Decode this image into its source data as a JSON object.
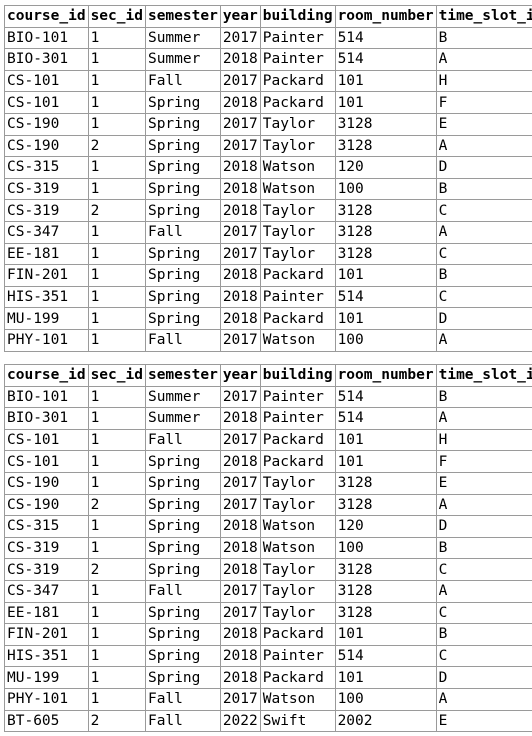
{
  "columns": [
    "course_id",
    "sec_id",
    "semester",
    "year",
    "building",
    "room_number",
    "time_slot_id"
  ],
  "result_before": {
    "rows": [
      [
        "BIO-101",
        "1",
        "Summer",
        "2017",
        "Painter",
        "514",
        "B"
      ],
      [
        "BIO-301",
        "1",
        "Summer",
        "2018",
        "Painter",
        "514",
        "A"
      ],
      [
        "CS-101",
        "1",
        "Fall",
        "2017",
        "Packard",
        "101",
        "H"
      ],
      [
        "CS-101",
        "1",
        "Spring",
        "2018",
        "Packard",
        "101",
        "F"
      ],
      [
        "CS-190",
        "1",
        "Spring",
        "2017",
        "Taylor",
        "3128",
        "E"
      ],
      [
        "CS-190",
        "2",
        "Spring",
        "2017",
        "Taylor",
        "3128",
        "A"
      ],
      [
        "CS-315",
        "1",
        "Spring",
        "2018",
        "Watson",
        "120",
        "D"
      ],
      [
        "CS-319",
        "1",
        "Spring",
        "2018",
        "Watson",
        "100",
        "B"
      ],
      [
        "CS-319",
        "2",
        "Spring",
        "2018",
        "Taylor",
        "3128",
        "C"
      ],
      [
        "CS-347",
        "1",
        "Fall",
        "2017",
        "Taylor",
        "3128",
        "A"
      ],
      [
        "EE-181",
        "1",
        "Spring",
        "2017",
        "Taylor",
        "3128",
        "C"
      ],
      [
        "FIN-201",
        "1",
        "Spring",
        "2018",
        "Packard",
        "101",
        "B"
      ],
      [
        "HIS-351",
        "1",
        "Spring",
        "2018",
        "Painter",
        "514",
        "C"
      ],
      [
        "MU-199",
        "1",
        "Spring",
        "2018",
        "Packard",
        "101",
        "D"
      ],
      [
        "PHY-101",
        "1",
        "Fall",
        "2017",
        "Watson",
        "100",
        "A"
      ]
    ]
  },
  "result_after": {
    "rows": [
      [
        "BIO-101",
        "1",
        "Summer",
        "2017",
        "Painter",
        "514",
        "B"
      ],
      [
        "BIO-301",
        "1",
        "Summer",
        "2018",
        "Painter",
        "514",
        "A"
      ],
      [
        "CS-101",
        "1",
        "Fall",
        "2017",
        "Packard",
        "101",
        "H"
      ],
      [
        "CS-101",
        "1",
        "Spring",
        "2018",
        "Packard",
        "101",
        "F"
      ],
      [
        "CS-190",
        "1",
        "Spring",
        "2017",
        "Taylor",
        "3128",
        "E"
      ],
      [
        "CS-190",
        "2",
        "Spring",
        "2017",
        "Taylor",
        "3128",
        "A"
      ],
      [
        "CS-315",
        "1",
        "Spring",
        "2018",
        "Watson",
        "120",
        "D"
      ],
      [
        "CS-319",
        "1",
        "Spring",
        "2018",
        "Watson",
        "100",
        "B"
      ],
      [
        "CS-319",
        "2",
        "Spring",
        "2018",
        "Taylor",
        "3128",
        "C"
      ],
      [
        "CS-347",
        "1",
        "Fall",
        "2017",
        "Taylor",
        "3128",
        "A"
      ],
      [
        "EE-181",
        "1",
        "Spring",
        "2017",
        "Taylor",
        "3128",
        "C"
      ],
      [
        "FIN-201",
        "1",
        "Spring",
        "2018",
        "Packard",
        "101",
        "B"
      ],
      [
        "HIS-351",
        "1",
        "Spring",
        "2018",
        "Painter",
        "514",
        "C"
      ],
      [
        "MU-199",
        "1",
        "Spring",
        "2018",
        "Packard",
        "101",
        "D"
      ],
      [
        "PHY-101",
        "1",
        "Fall",
        "2017",
        "Watson",
        "100",
        "A"
      ],
      [
        "BT-605",
        "2",
        "Fall",
        "2022",
        "Swift",
        "2002",
        "E"
      ]
    ]
  }
}
